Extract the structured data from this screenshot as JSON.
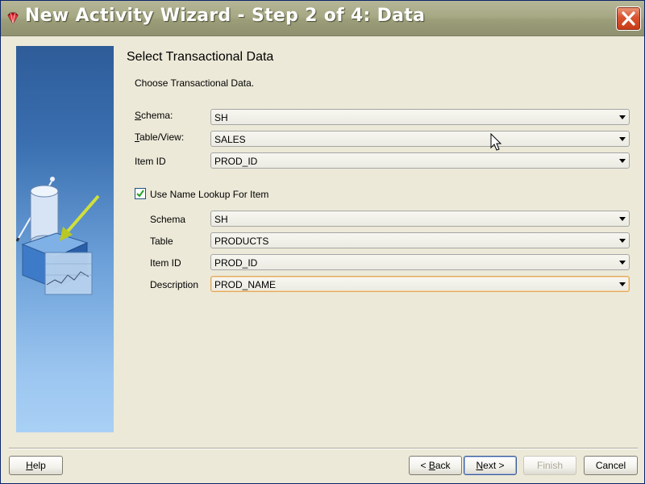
{
  "window": {
    "title": "New Activity Wizard - Step 2 of 4: Data"
  },
  "colors": {
    "titlebar": "#a7a985",
    "close_button": "#d9532e",
    "banner_top": "#2e5c99",
    "banner_bottom": "#a9d0f5",
    "focus_border": "#e0a85a"
  },
  "icons": {
    "app": "ruby-diamond-icon",
    "close": "close-x-icon",
    "checkbox": "checkmark-icon",
    "cursor": "mouse-pointer-icon"
  },
  "content": {
    "title": "Select Transactional Data",
    "subtitle": "Choose Transactional Data."
  },
  "transactional": {
    "schema": {
      "label_mnemonic": "S",
      "label_rest": "chema:",
      "value": "SH"
    },
    "table_view": {
      "label_mnemonic": "T",
      "label_rest": "able/View:",
      "value": "SALES"
    },
    "item_id": {
      "label": "Item ID",
      "value": "PROD_ID"
    }
  },
  "lookup": {
    "checkbox_label": "Use Name Lookup For Item",
    "checked": true,
    "schema": {
      "label": "Schema",
      "value": "SH"
    },
    "table": {
      "label": "Table",
      "value": "PRODUCTS"
    },
    "item_id": {
      "label": "Item ID",
      "value": "PROD_ID"
    },
    "description": {
      "label": "Description",
      "value": "PROD_NAME"
    }
  },
  "buttons": {
    "help": {
      "mnemonic": "H",
      "rest": "elp"
    },
    "back": {
      "prefix": "< ",
      "mnemonic": "B",
      "rest": "ack"
    },
    "next": {
      "mnemonic": "N",
      "rest": "ext >"
    },
    "finish": {
      "label": "Finish"
    },
    "cancel": {
      "label": "Cancel"
    }
  }
}
